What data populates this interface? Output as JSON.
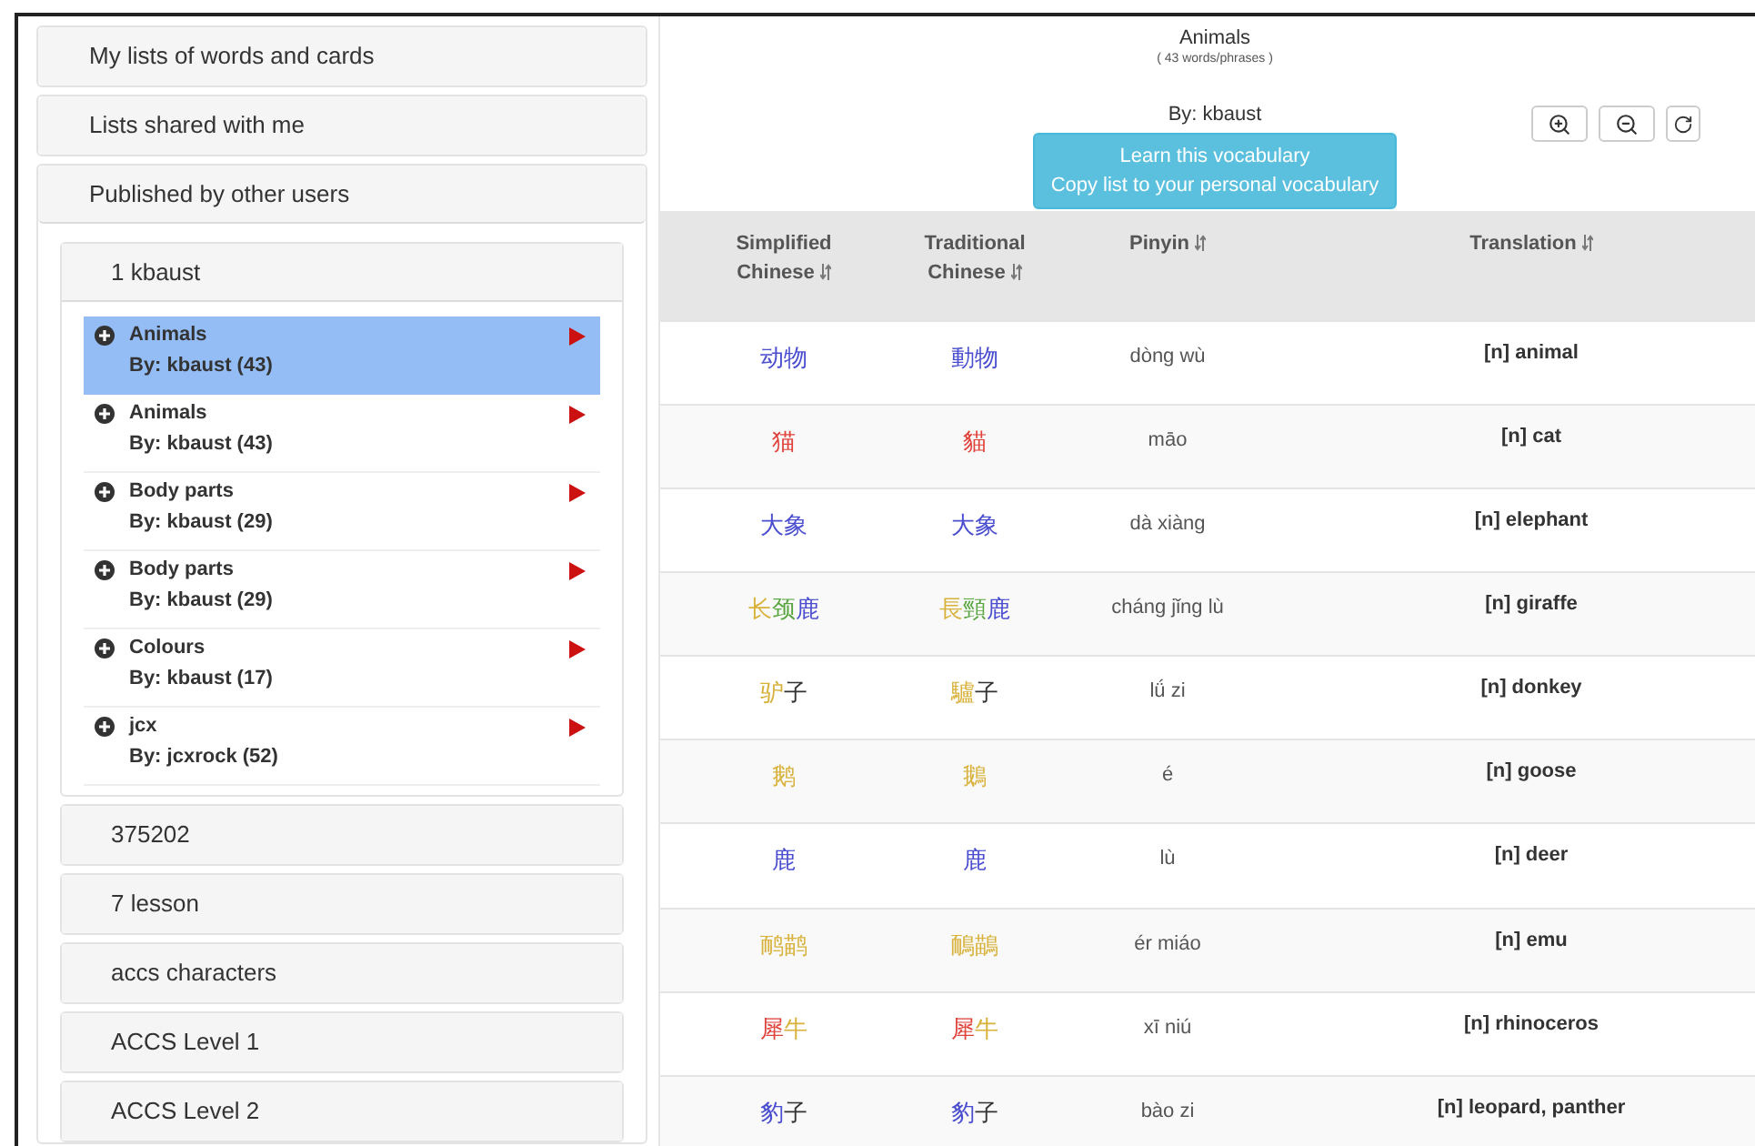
{
  "sidebar": {
    "sections": [
      {
        "label": "My lists of words and cards",
        "expanded": false
      },
      {
        "label": "Lists shared with me",
        "expanded": false
      },
      {
        "label": "Published by other users",
        "expanded": true,
        "groups": [
          {
            "label": "1 kbaust",
            "expanded": true,
            "lists": [
              {
                "title": "Animals",
                "author": "By: kbaust (43)",
                "selected": true
              },
              {
                "title": "Animals",
                "author": "By: kbaust (43)",
                "selected": false
              },
              {
                "title": "Body parts",
                "author": "By: kbaust (29)",
                "selected": false
              },
              {
                "title": "Body parts",
                "author": "By: kbaust (29)",
                "selected": false
              },
              {
                "title": "Colours",
                "author": "By: kbaust (17)",
                "selected": false
              },
              {
                "title": "jcx",
                "author": "By: jcxrock (52)",
                "selected": false
              }
            ]
          },
          {
            "label": "375202",
            "expanded": false
          },
          {
            "label": "7 lesson",
            "expanded": false
          },
          {
            "label": "accs characters",
            "expanded": false
          },
          {
            "label": "ACCS Level 1",
            "expanded": false
          },
          {
            "label": "ACCS Level 2",
            "expanded": false
          }
        ]
      }
    ]
  },
  "main": {
    "title": "Animals",
    "subtitle": "( 43 words/phrases )",
    "author": "By: kbaust",
    "action_button": {
      "lines": [
        "Learn this vocabulary",
        "Copy list to your personal vocabulary"
      ]
    },
    "table": {
      "columns": [
        "Simplified Chinese",
        "Traditional Chinese",
        "Pinyin",
        "Translation"
      ],
      "rows": [
        {
          "simplified": [
            {
              "text": "动物",
              "color": "#4b4fcf"
            }
          ],
          "traditional": [
            {
              "text": "動物",
              "color": "#4b4fcf"
            }
          ],
          "pinyin": "dòng wù",
          "translation": "[n] animal"
        },
        {
          "simplified": [
            {
              "text": "猫",
              "color": "#e0413a"
            }
          ],
          "traditional": [
            {
              "text": "貓",
              "color": "#e0413a"
            }
          ],
          "pinyin": "māo",
          "translation": "[n] cat"
        },
        {
          "simplified": [
            {
              "text": "大象",
              "color": "#4b4fcf"
            }
          ],
          "traditional": [
            {
              "text": "大象",
              "color": "#4b4fcf"
            }
          ],
          "pinyin": "dà xiàng",
          "translation": "[n] elephant"
        },
        {
          "simplified": [
            {
              "text": "长",
              "color": "#d8b23c"
            },
            {
              "text": "颈",
              "color": "#58a63f"
            },
            {
              "text": "鹿",
              "color": "#4b4fcf"
            }
          ],
          "traditional": [
            {
              "text": "長",
              "color": "#d8b23c"
            },
            {
              "text": "頸",
              "color": "#58a63f"
            },
            {
              "text": "鹿",
              "color": "#4b4fcf"
            }
          ],
          "pinyin": "cháng jǐng lù",
          "translation": "[n] giraffe"
        },
        {
          "simplified": [
            {
              "text": "驴",
              "color": "#d8b23c"
            },
            {
              "text": "子",
              "color": "#333333"
            }
          ],
          "traditional": [
            {
              "text": "驢",
              "color": "#d8b23c"
            },
            {
              "text": "子",
              "color": "#333333"
            }
          ],
          "pinyin": "lǘ zi",
          "translation": "[n] donkey"
        },
        {
          "simplified": [
            {
              "text": "鹅",
              "color": "#d8b23c"
            }
          ],
          "traditional": [
            {
              "text": "鵝",
              "color": "#d8b23c"
            }
          ],
          "pinyin": "é",
          "translation": "[n] goose"
        },
        {
          "simplified": [
            {
              "text": "鹿",
              "color": "#4b4fcf"
            }
          ],
          "traditional": [
            {
              "text": "鹿",
              "color": "#4b4fcf"
            }
          ],
          "pinyin": "lù",
          "translation": "[n] deer"
        },
        {
          "simplified": [
            {
              "text": "鸸鹋",
              "color": "#d8b23c"
            }
          ],
          "traditional": [
            {
              "text": "鴯鶓",
              "color": "#d8b23c"
            }
          ],
          "pinyin": "ér miáo",
          "translation": "[n] emu"
        },
        {
          "simplified": [
            {
              "text": "犀",
              "color": "#e0413a"
            },
            {
              "text": "牛",
              "color": "#d8b23c"
            }
          ],
          "traditional": [
            {
              "text": "犀",
              "color": "#e0413a"
            },
            {
              "text": "牛",
              "color": "#d8b23c"
            }
          ],
          "pinyin": "xī niú",
          "translation": "[n] rhinoceros"
        },
        {
          "simplified": [
            {
              "text": "豹",
              "color": "#4b4fcf"
            },
            {
              "text": "子",
              "color": "#333333"
            }
          ],
          "traditional": [
            {
              "text": "豹",
              "color": "#4b4fcf"
            },
            {
              "text": "子",
              "color": "#333333"
            }
          ],
          "pinyin": "bào zi",
          "translation": "[n] leopard, panther"
        }
      ]
    }
  }
}
